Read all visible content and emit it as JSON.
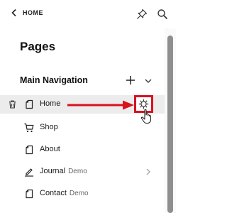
{
  "header": {
    "back_label": "HOME",
    "icons": {
      "back": "chevron-left-icon",
      "pin": "pin-icon",
      "search": "search-icon"
    }
  },
  "page_title": "Pages",
  "navigation": {
    "section_title": "Main Navigation",
    "items": [
      {
        "label": "Home",
        "tag": "",
        "icon": "page-icon",
        "selected": true
      },
      {
        "label": "Shop",
        "tag": "",
        "icon": "cart-icon"
      },
      {
        "label": "About",
        "tag": "",
        "icon": "page-icon"
      },
      {
        "label": "Journal",
        "tag": "Demo",
        "icon": "blog-icon"
      },
      {
        "label": "Contact",
        "tag": "Demo",
        "icon": "page-icon"
      }
    ]
  },
  "annotation": {
    "highlight_color": "#d9121f"
  }
}
